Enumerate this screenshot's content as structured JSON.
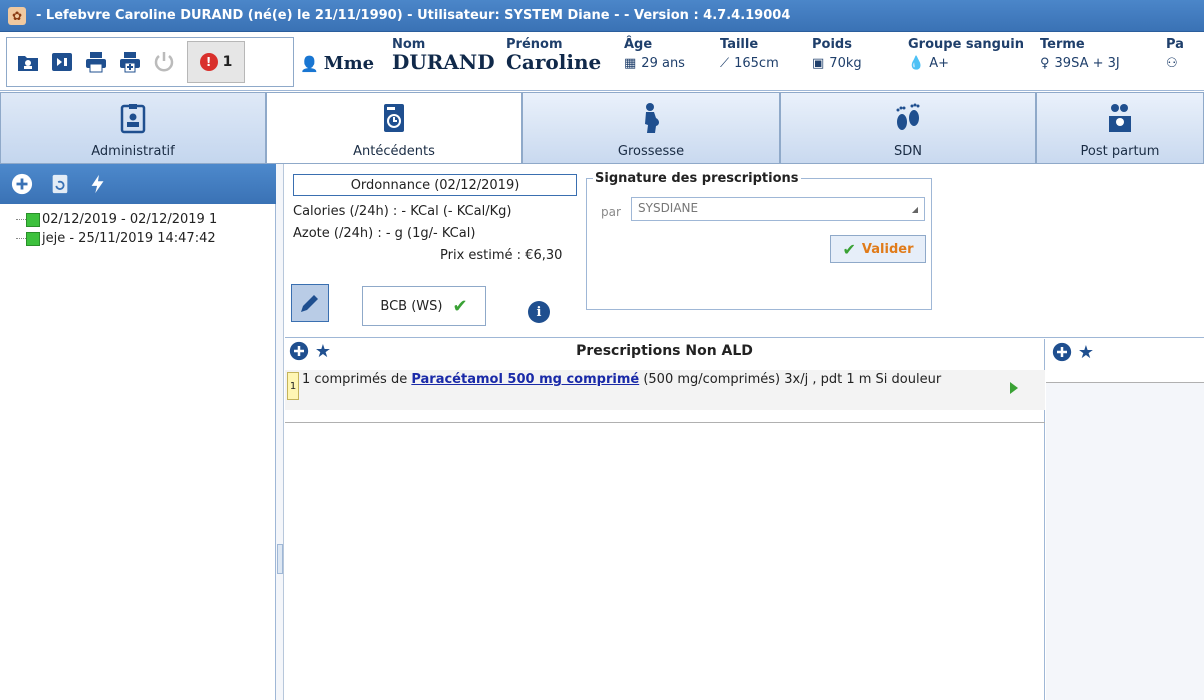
{
  "window": {
    "title": "- Lefebvre Caroline DURAND (né(e) le 21/11/1990) - Utilisateur: SYSTEM Diane - - Version : 4.7.4.19004"
  },
  "toolbar": {
    "alert_count": "1",
    "alert_symbol": "!"
  },
  "patient": {
    "civility": "Mme",
    "nom_label": "Nom",
    "nom": "DURAND",
    "prenom_label": "Prénom",
    "prenom": "Caroline",
    "age_label": "Âge",
    "age": "29 ans",
    "taille_label": "Taille",
    "taille": "165cm",
    "poids_label": "Poids",
    "poids": "70kg",
    "groupe_label": "Groupe sanguin",
    "groupe": "A+",
    "terme_label": "Terme",
    "terme": "39SA + 3J",
    "extra_label": "Pa"
  },
  "tabs": [
    {
      "label": "Administratif"
    },
    {
      "label": "Antécédents"
    },
    {
      "label": "Grossesse"
    },
    {
      "label": "SDN"
    },
    {
      "label": "Post partum"
    }
  ],
  "tree": {
    "items": [
      {
        "label": "02/12/2019 - 02/12/2019 1"
      },
      {
        "label": "jeje - 25/11/2019 14:47:42"
      }
    ]
  },
  "ordonnance": {
    "title": "Ordonnance (02/12/2019)",
    "calories": "Calories (/24h) : - KCal (- KCal/Kg)",
    "azote": "Azote (/24h) : - g (1g/- KCal)",
    "prix": "Prix estimé : €6,30",
    "bcb_label": "BCB (WS)",
    "info_symbol": "i"
  },
  "signature": {
    "legend": "Signature des prescriptions",
    "par_label": "par",
    "selected": "SYSDIANE",
    "valider_label": "Valider"
  },
  "prescriptions": {
    "title": "Prescriptions Non ALD",
    "rows": [
      {
        "num": "1",
        "prefix": "1 comprimés de ",
        "drug": "Paracétamol 500 mg comprimé",
        "suffix": " (500 mg/comprimés) 3x/j , pdt 1 m Si douleur"
      }
    ]
  },
  "colors": {
    "titlebar": "#3a72b5",
    "accent": "#1f4f8f",
    "valider_text": "#e07b1a",
    "check_green": "#3aa235"
  }
}
